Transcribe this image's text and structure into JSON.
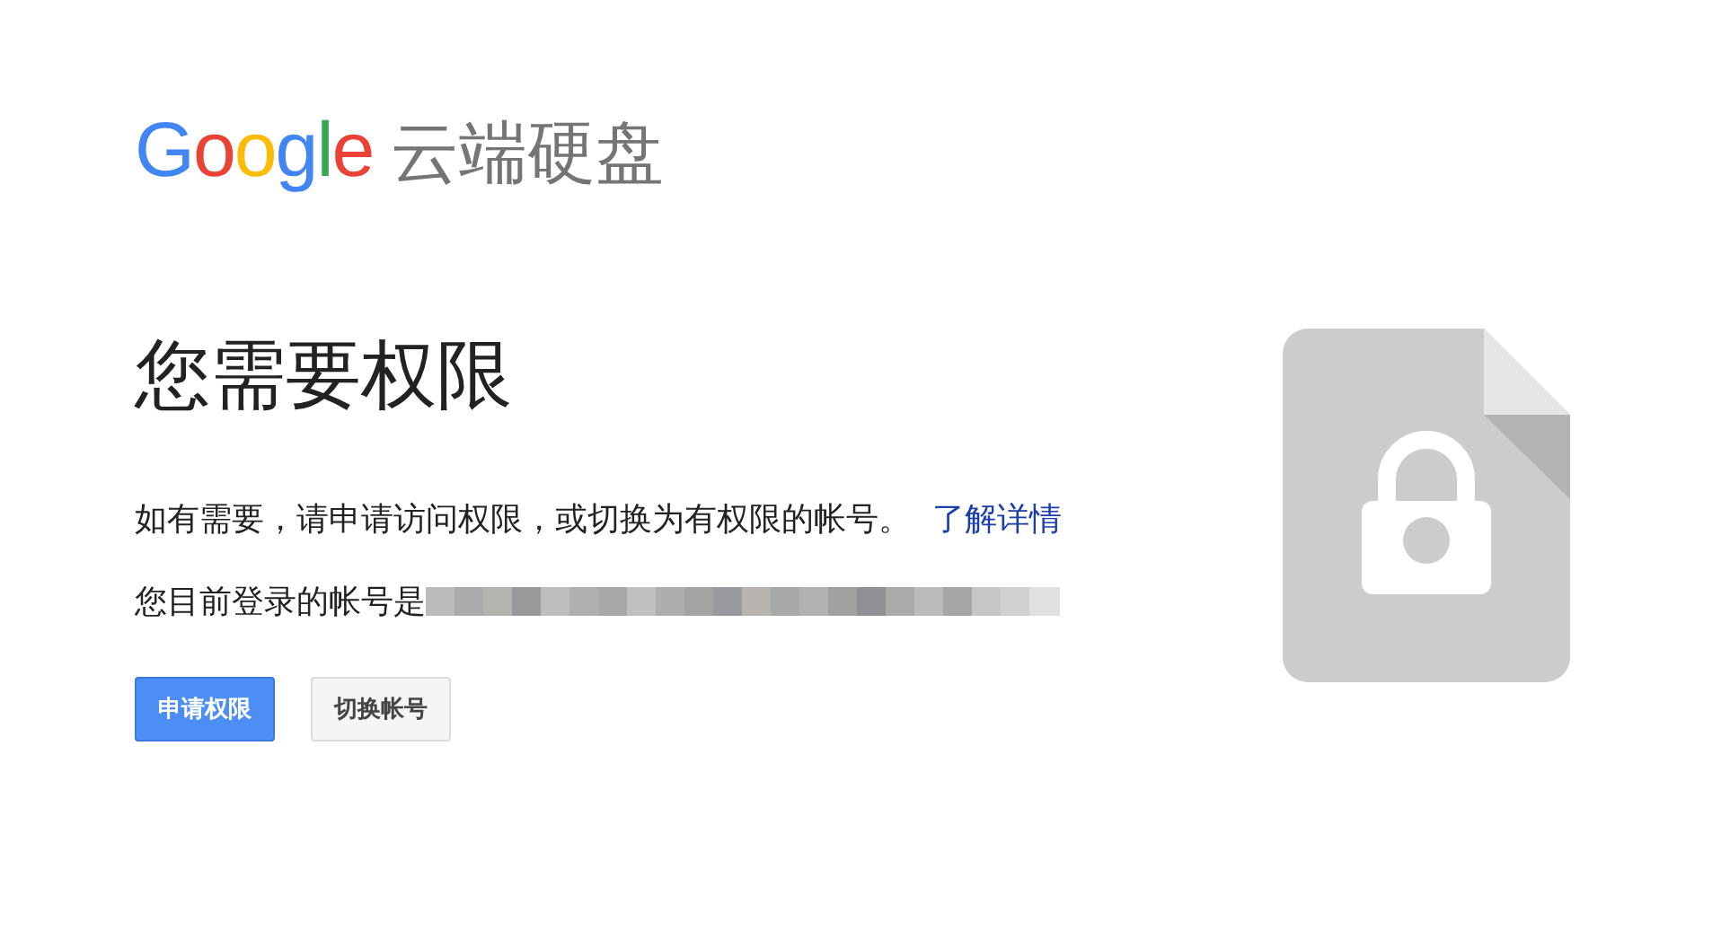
{
  "logo": {
    "brand": "Google",
    "product": "云端硬盘"
  },
  "heading": "您需要权限",
  "message": "如有需要，请申请访问权限，或切换为有权限的帐号。",
  "learn_more_link": "了解详情",
  "account_label": "您目前登录的帐号是",
  "buttons": [
    {
      "label": "申请权限",
      "kind": "primary"
    },
    {
      "label": "切换帐号",
      "kind": "secondary"
    }
  ]
}
